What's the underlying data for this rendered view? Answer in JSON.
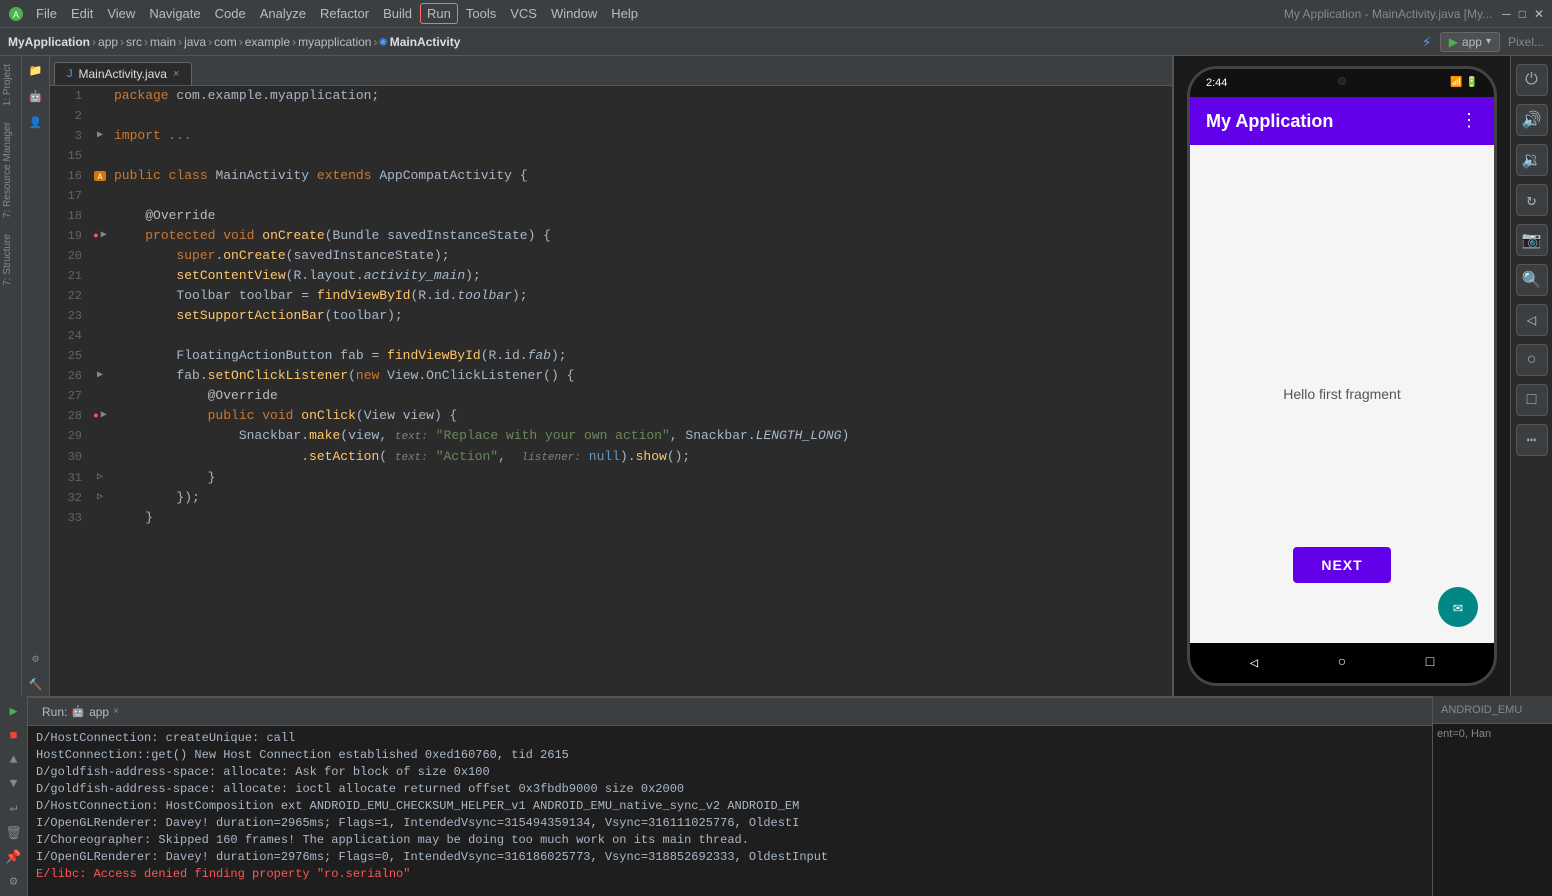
{
  "window_title": "My Application - MainActivity.java [My...",
  "menu": {
    "items": [
      "File",
      "Edit",
      "View",
      "Navigate",
      "Code",
      "Analyze",
      "Refactor",
      "Build",
      "Run",
      "Tools",
      "VCS",
      "Window",
      "Help"
    ]
  },
  "breadcrumb": {
    "items": [
      "MyApplication",
      "app",
      "src",
      "main",
      "java",
      "com",
      "example",
      "myapplication",
      "MainActivity"
    ]
  },
  "run_config": {
    "label": "app",
    "device": "Pixel..."
  },
  "tab": {
    "label": "MainActivity.java",
    "close": "×"
  },
  "code": {
    "lines": [
      {
        "num": 1,
        "content": "package com.example.myapplication;"
      },
      {
        "num": 2,
        "content": ""
      },
      {
        "num": 3,
        "content": "import ..."
      },
      {
        "num": 15,
        "content": ""
      },
      {
        "num": 16,
        "content": "public class MainActivity extends AppCompatActivity {"
      },
      {
        "num": 17,
        "content": ""
      },
      {
        "num": 18,
        "content": "    @Override"
      },
      {
        "num": 19,
        "content": "    protected void onCreate(Bundle savedInstanceState) {"
      },
      {
        "num": 20,
        "content": "        super.onCreate(savedInstanceState);"
      },
      {
        "num": 21,
        "content": "        setContentView(R.layout.activity_main);"
      },
      {
        "num": 22,
        "content": "        Toolbar toolbar = findViewById(R.id.toolbar);"
      },
      {
        "num": 23,
        "content": "        setSupportActionBar(toolbar);"
      },
      {
        "num": 24,
        "content": ""
      },
      {
        "num": 25,
        "content": "        FloatingActionButton fab = findViewById(R.id.fab);"
      },
      {
        "num": 26,
        "content": "        fab.setOnClickListener(new View.OnClickListener() {"
      },
      {
        "num": 27,
        "content": "            @Override"
      },
      {
        "num": 28,
        "content": "            public void onClick(View view) {"
      },
      {
        "num": 29,
        "content": "                Snackbar.make(view, \"Replace with your own action\", Snackbar.LENGTH_LONG)"
      },
      {
        "num": 30,
        "content": "                        .setAction( text: \"Action\",  listener: null).show();"
      },
      {
        "num": 31,
        "content": "            }"
      },
      {
        "num": 32,
        "content": "        });"
      },
      {
        "num": 33,
        "content": "    }"
      }
    ]
  },
  "run_panel": {
    "tab_label": "Run:",
    "app_label": "app",
    "close": "×",
    "logs": [
      "D/HostConnection: createUnique: call",
      "    HostConnection::get() New Host Connection established 0xed160760, tid 2615",
      "D/goldfish-address-space: allocate: Ask for block of size 0x100",
      "D/goldfish-address-space: allocate: ioctl allocate returned offset 0x3fbdb9000 size 0x2000",
      "D/HostConnection: HostComposition ext ANDROID_EMU_CHECKSUM_HELPER_v1 ANDROID_EMU_native_sync_v2 ANDROID_EM",
      "I/OpenGLRenderer: Davey! duration=2965ms; Flags=1, IntendedVsync=315494359134, Vsync=316111025776, OldestI",
      "I/Choreographer: Skipped 160 frames!  The application may be doing too much work on its main thread.",
      "I/OpenGLRenderer: Davey! duration=2976ms; Flags=0, IntendedVsync=316186025773, Vsync=318852692333, OldestInput",
      "E/libc: Access denied finding property \"ro.serialno\""
    ]
  },
  "emulator": {
    "phone": {
      "time": "2:44",
      "app_title": "My Application",
      "fragment_text": "Hello first fragment",
      "next_button": "NEXT"
    },
    "toolbar_buttons": [
      "power",
      "volume-up",
      "volume-down",
      "rotate",
      "camera",
      "zoom-in",
      "back",
      "home",
      "overview",
      "more"
    ]
  },
  "right_panel_label": "ANDROID_EMU",
  "bottom_right_label": "ent=0, Han"
}
